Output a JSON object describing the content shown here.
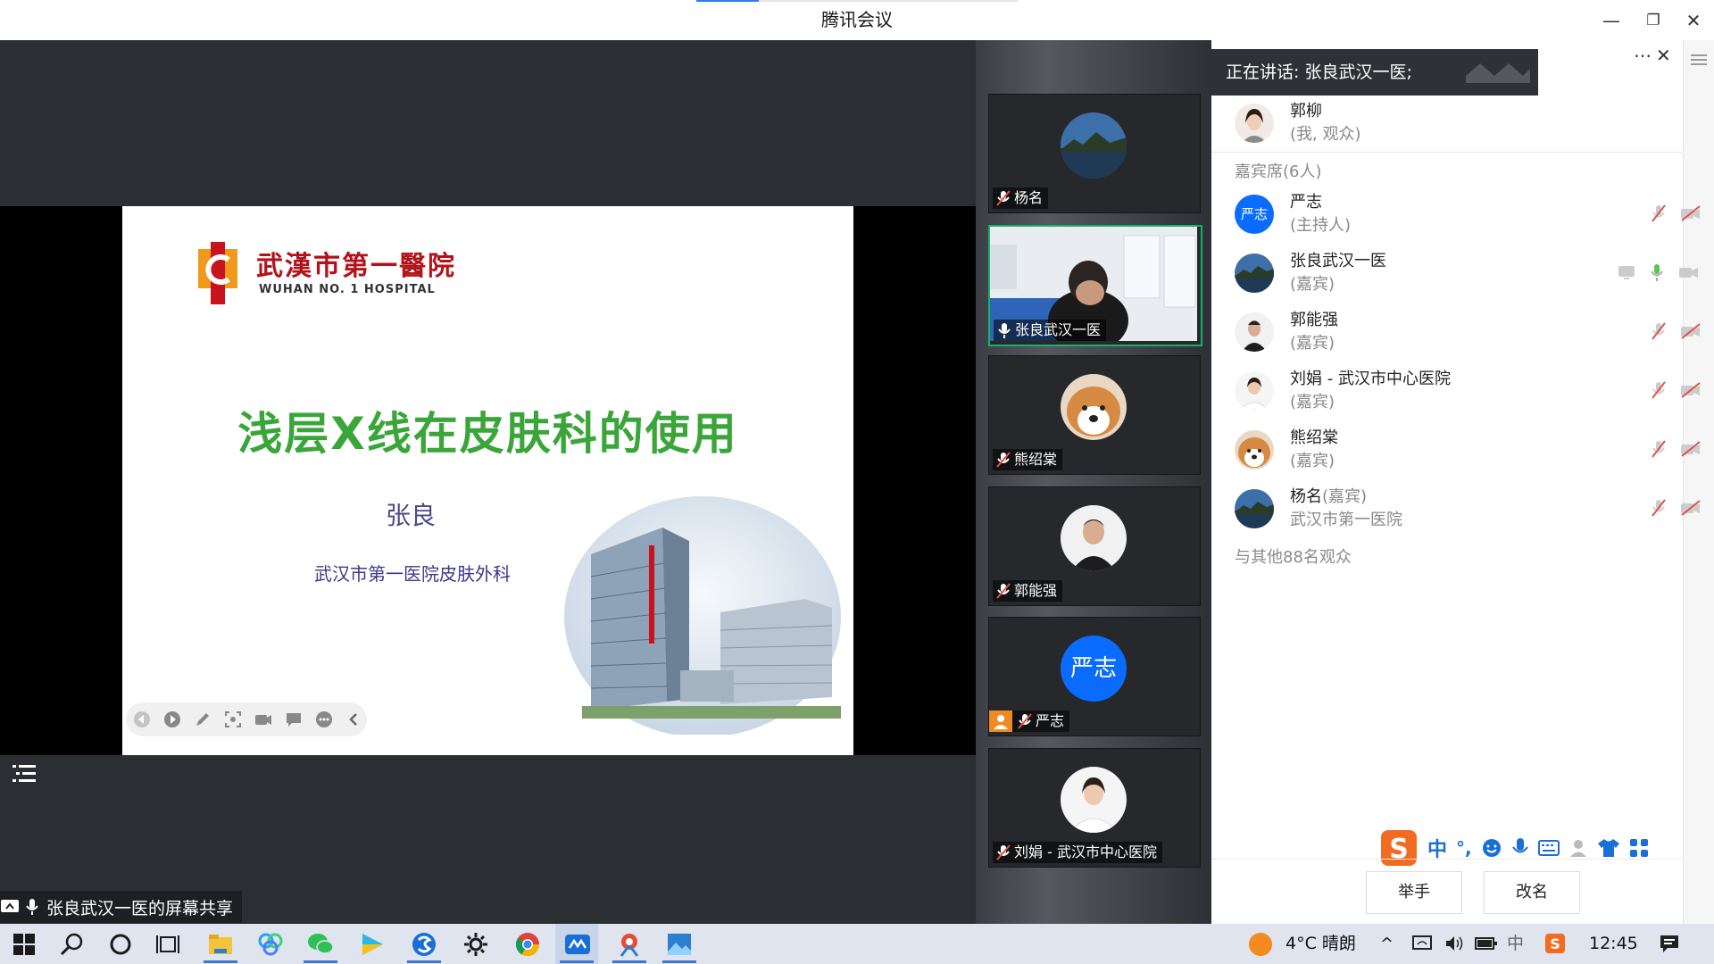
{
  "window": {
    "title": "腾讯会议"
  },
  "slide": {
    "logo_cn": "武漢市第一醫院",
    "logo_en": "WUHAN  NO. 1   HOSPITAL",
    "title": "浅层X线在皮肤科的使用",
    "author": "张良",
    "dept": "武汉市第一医院皮肤外科"
  },
  "share_bar": {
    "text": "张良武汉一医的屏幕共享"
  },
  "speaking": {
    "text": "正在讲话: 张良武汉一医;"
  },
  "tiles": [
    {
      "name": "杨名"
    },
    {
      "name": "张良武汉一医"
    },
    {
      "name": "熊绍棠"
    },
    {
      "name": "郭能强"
    },
    {
      "name": "严志",
      "avatar_text": "严志"
    },
    {
      "name": "刘娟 - 武汉市中心医院"
    }
  ],
  "participants": {
    "me": {
      "name": "郭柳",
      "role": "(我, 观众)"
    },
    "guest_header": "嘉宾席(6人)",
    "list": [
      {
        "name": "严志",
        "role": "(主持人)",
        "avatar_text": "严志"
      },
      {
        "name": "张良武汉一医",
        "role": "(嘉宾)"
      },
      {
        "name": "郭能强",
        "role": "(嘉宾)"
      },
      {
        "name": "刘娟 - 武汉市中心医院",
        "role": "(嘉宾)"
      },
      {
        "name": "熊绍棠",
        "role": "(嘉宾)"
      },
      {
        "name": "杨名",
        "name_suffix": "(嘉宾)",
        "role": "武汉市第一医院"
      }
    ],
    "others": "与其他88名观众"
  },
  "buttons": {
    "raise_hand": "举手",
    "rename": "改名"
  },
  "ime": {
    "mode": "中",
    "punct": "°,"
  },
  "taskbar": {
    "weather": "4°C  晴朗",
    "ime_indicator": "中",
    "time": "12:45"
  },
  "colors": {
    "accent": "#2b7fe8",
    "host_blue": "#0a6cff",
    "active_green": "#18b06a",
    "slide_title_green": "#3aa63a",
    "muted_red": "#e0524a"
  }
}
